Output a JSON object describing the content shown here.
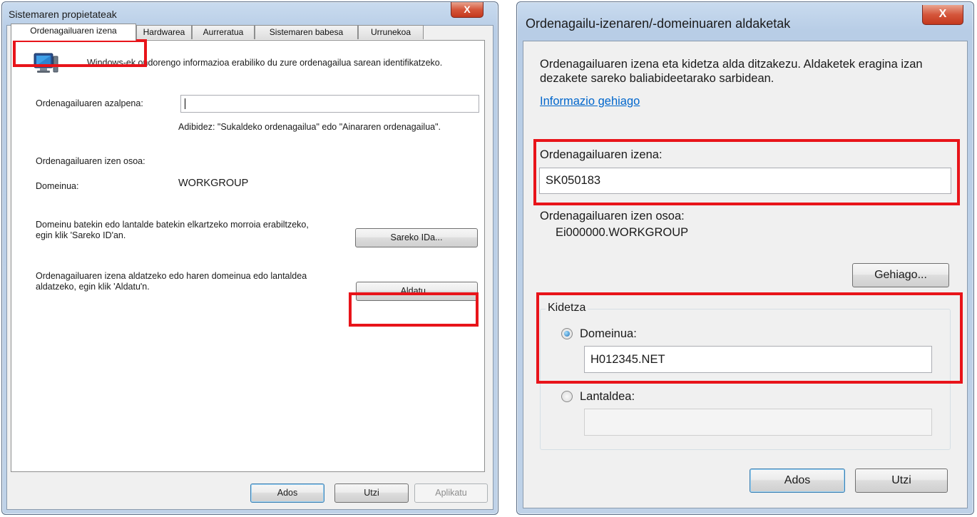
{
  "left_dialog": {
    "title": "Sistemaren propietateak",
    "close_label": "X",
    "tabs": [
      {
        "label": "Ordenagailuaren izena"
      },
      {
        "label": "Hardwarea"
      },
      {
        "label": "Aurreratua"
      },
      {
        "label": "Sistemaren babesa"
      },
      {
        "label": "Urrunekoa"
      }
    ],
    "intro_text": "Windows-ek ondorengo informazioa erabiliko du zure ordenagailua sarean identifikatzeko.",
    "description_label": "Ordenagailuaren azalpena:",
    "description_value": "",
    "example_text": "Adibidez: \"Sukaldeko ordenagailua\" edo \"Ainararen ordenagailua\".",
    "full_name_label": "Ordenagailuaren izen osoa:",
    "full_name_value": "",
    "domain_label": "Domeinua:",
    "domain_value": "WORKGROUP",
    "network_id_text": "Domeinu batekin edo lantalde batekin elkartzeko morroia erabiltzeko, egin klik 'Sareko ID'an.",
    "network_id_button": "Sareko IDa...",
    "change_text": "Ordenagailuaren izena aldatzeko edo haren domeinua edo lantaldea aldatzeko, egin klik 'Aldatu'n.",
    "change_button": "Aldatu...",
    "ok_button": "Ados",
    "cancel_button": "Utzi",
    "apply_button": "Aplikatu"
  },
  "right_dialog": {
    "title": "Ordenagailu-izenaren/-domeinuaren aldaketak",
    "close_label": "X",
    "intro_text": "Ordenagailuaren izena eta kidetza alda ditzakezu. Aldaketek eragina izan dezakete sareko baliabideetarako sarbidean.",
    "more_info_link": "Informazio gehiago",
    "computer_name_label": "Ordenagailuaren izena:",
    "computer_name_value": "SK050183",
    "full_name_label": "Ordenagailuaren izen osoa:",
    "full_name_value": "Ei000000.WORKGROUP",
    "more_button": "Gehiago...",
    "member_of_label": "Kidetza",
    "domain_radio_label": "Domeinua:",
    "domain_value": "H012345.NET",
    "workgroup_radio_label": "Lantaldea:",
    "workgroup_value": "",
    "ok_button": "Ados",
    "cancel_button": "Utzi"
  },
  "colors": {
    "highlight": "#e8141a",
    "link": "#0066cc"
  },
  "icons": [
    "computer-icon",
    "close-icon",
    "radio-checked-icon",
    "radio-unchecked-icon"
  ]
}
